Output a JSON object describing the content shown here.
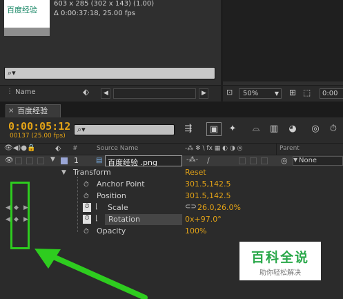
{
  "project_panel": {
    "thumbnail_text": "百度经验",
    "dimensions": "603 x 285  (302 x 143) (1.00)",
    "duration": "Δ 0:00:37:18, 25.00 fps",
    "search_glyph": "⌕▾",
    "column_name": "Name",
    "tag_icon": "tag-icon"
  },
  "viewer_panel": {
    "zoom": "50%",
    "timecode": "0:00"
  },
  "timeline": {
    "tab_label": "百度经验",
    "current_time": "0:00:05:12",
    "frame_info": "00137 (25.00 fps)",
    "search_glyph": "⌕▾",
    "columns": {
      "number": "#",
      "source_name": "Source Name",
      "parent": "Parent",
      "switches": "-⁂ ✻ \\ fx ▦ ◐ ◑ ◎"
    },
    "layer": {
      "number": "1",
      "name": "百度经验 .png",
      "parent": "None"
    },
    "transform": {
      "label": "Transform",
      "reset": "Reset",
      "properties": [
        {
          "name": "Anchor Point",
          "value": "301.5,142.5"
        },
        {
          "name": "Position",
          "value": "301.5,142.5"
        },
        {
          "name": "Scale",
          "value": "26.0,26.0%"
        },
        {
          "name": "Rotation",
          "value": "0x+97.0°"
        },
        {
          "name": "Opacity",
          "value": "100%"
        }
      ]
    }
  },
  "watermark": {
    "title": "百科全说",
    "subtitle": "助你轻松解决"
  },
  "colors": {
    "accent_orange": "#e3a317",
    "highlight_green": "#2ecc1f",
    "watermark_green": "#2aa84a"
  }
}
